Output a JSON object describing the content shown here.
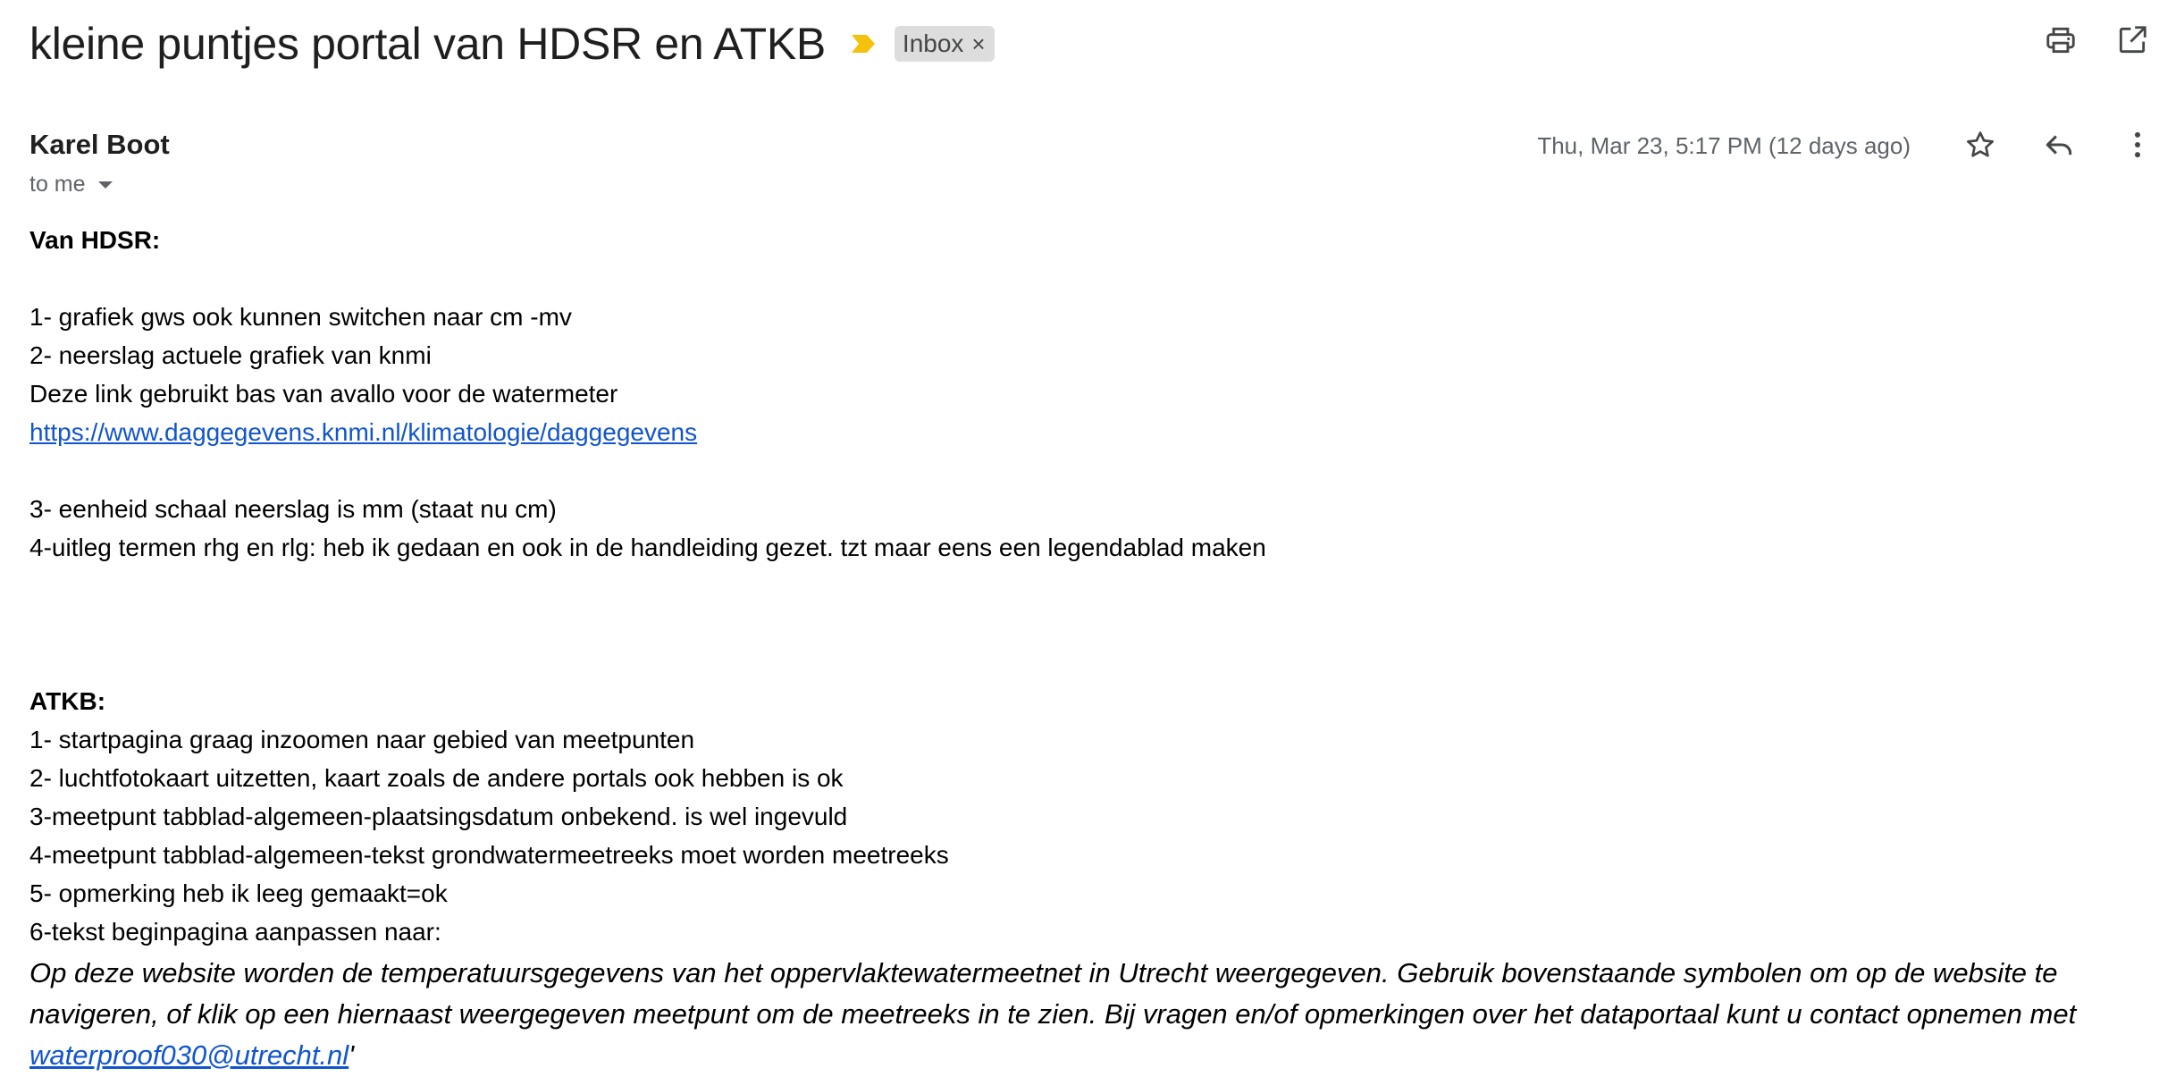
{
  "email": {
    "subject": "kleine puntjes portal van HDSR en ATKB",
    "label": "Inbox",
    "label_remove": "×",
    "sender": "Karel Boot",
    "recipient": "to me",
    "date": "Thu, Mar 23, 5:17 PM (12 days ago)",
    "importance_color": "#f4c20d"
  },
  "icons": {
    "print": "print-icon",
    "open_new_window": "open-in-new-window-icon",
    "star": "star-icon",
    "reply": "reply-icon",
    "more": "more-vert-icon",
    "importance": "importance-marker-icon"
  },
  "body": {
    "hdsr_heading": "Van HDSR:",
    "hdsr_1": "1- grafiek gws ook kunnen switchen naar cm -mv",
    "hdsr_2": "2- neerslag actuele grafiek van knmi",
    "hdsr_link_intro": "Deze link gebruikt bas van avallo voor de watermeter",
    "hdsr_link": "https://www.daggegevens.knmi.nl/klimatologie/daggegevens",
    "hdsr_3": "3- eenheid schaal neerslag is mm (staat nu cm)",
    "hdsr_4": "4-uitleg termen rhg en rlg: heb ik gedaan en ook in de handleiding gezet. tzt maar eens een legendablad maken",
    "atkb_heading": "ATKB:",
    "atkb_1": "1- startpagina graag inzoomen naar gebied van meetpunten",
    "atkb_2": "2- luchtfotokaart uitzetten, kaart zoals de andere portals ook hebben is ok",
    "atkb_3": "3-meetpunt tabblad-algemeen-plaatsingsdatum onbekend. is wel ingevuld",
    "atkb_4": "4-meetpunt tabblad-algemeen-tekst grondwatermeetreeks moet worden meetreeks",
    "atkb_5": "5- opmerking heb ik leeg gemaakt=ok",
    "atkb_6": "6-tekst beginpagina aanpassen naar:",
    "quote_text": "Op deze website worden de temperatuursgegevens van het oppervlaktewatermeetnet in Utrecht weergegeven. Gebruik bovenstaande symbolen om op de website te navigeren, of klik op een hiernaast weergegeven meetpunt om de meetreeks in te zien. Bij vragen en/of opmerkingen over het dataportaal kunt u contact opnemen met ",
    "quote_email": "waterproof030@utrecht.nl",
    "quote_end": "'"
  }
}
